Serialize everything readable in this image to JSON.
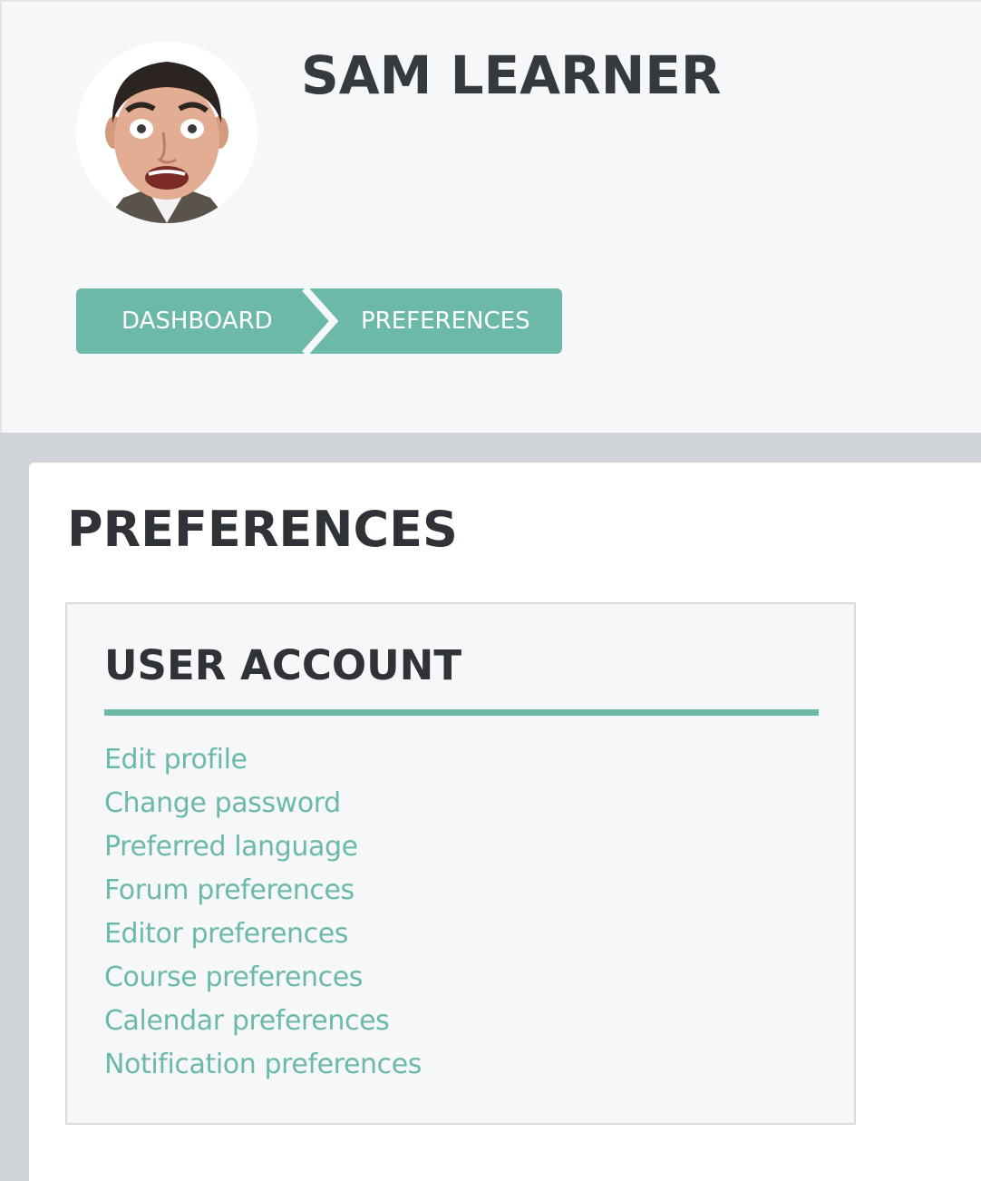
{
  "header": {
    "user_name": "SAM LEARNER",
    "avatar_icon": "user-avatar-photo"
  },
  "breadcrumb": {
    "items": [
      {
        "label": "DASHBOARD"
      },
      {
        "label": "PREFERENCES"
      }
    ]
  },
  "main": {
    "title": "PREFERENCES",
    "section": {
      "title": "USER ACCOUNT",
      "links": [
        {
          "label": "Edit profile"
        },
        {
          "label": "Change password"
        },
        {
          "label": "Preferred language"
        },
        {
          "label": "Forum preferences"
        },
        {
          "label": "Editor preferences"
        },
        {
          "label": "Course preferences"
        },
        {
          "label": "Calendar preferences"
        },
        {
          "label": "Notification preferences"
        }
      ]
    }
  },
  "colors": {
    "accent": "#6cb9a9",
    "heading": "#2f3338",
    "header_bg": "#f6f7f9",
    "page_bg": "#d0d4d9"
  }
}
